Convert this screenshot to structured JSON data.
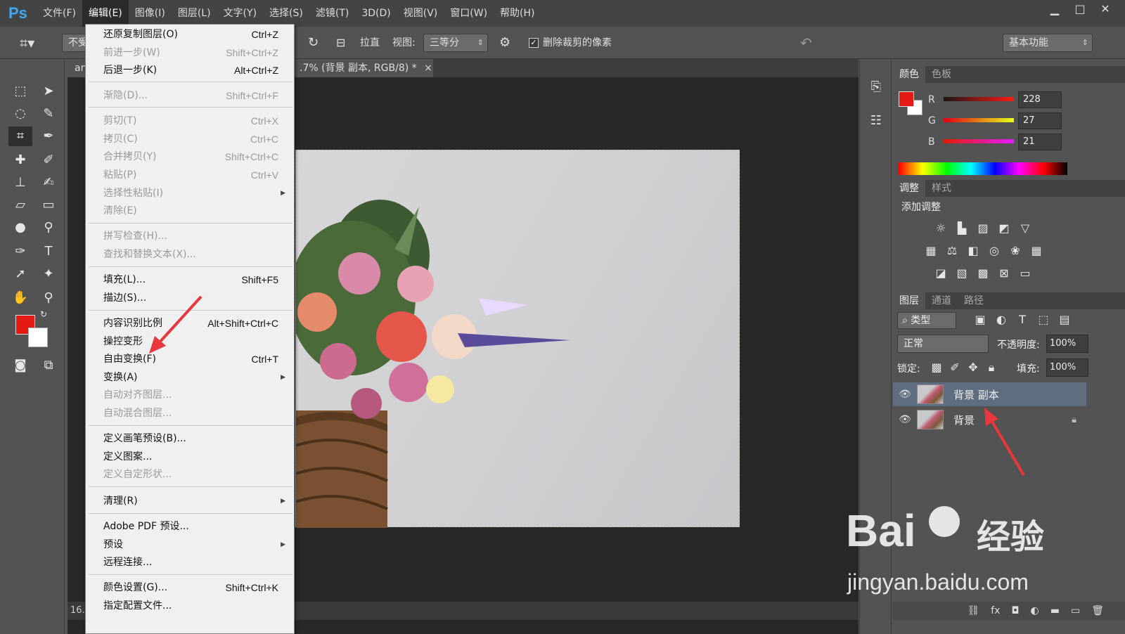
{
  "app": {
    "logo": "Ps"
  },
  "menubar": [
    {
      "label": "文件(F)"
    },
    {
      "label": "编辑(E)"
    },
    {
      "label": "图像(I)"
    },
    {
      "label": "图层(L)"
    },
    {
      "label": "文字(Y)"
    },
    {
      "label": "选择(S)"
    },
    {
      "label": "滤镜(T)"
    },
    {
      "label": "3D(D)"
    },
    {
      "label": "视图(V)"
    },
    {
      "label": "窗口(W)"
    },
    {
      "label": "帮助(H)"
    }
  ],
  "window_controls": {
    "minimize": "▁",
    "maximize": "□",
    "close": "✕"
  },
  "options_bar": {
    "ratio_label": "不受",
    "straighten": "拉直",
    "view_label": "视图:",
    "view_value": "三等分",
    "delete_cropped": "删除裁剪的像素",
    "workspace": "基本功能"
  },
  "document": {
    "tab_left": "an",
    "tab_title": ".7% (背景 副本, RGB/8) *",
    "tab_close": "×",
    "status": "16."
  },
  "edit_menu": [
    {
      "label": "还原复制图层(O)",
      "shortcut": "Ctrl+Z",
      "enabled": true
    },
    {
      "label": "前进一步(W)",
      "shortcut": "Shift+Ctrl+Z",
      "enabled": false
    },
    {
      "label": "后退一步(K)",
      "shortcut": "Alt+Ctrl+Z",
      "enabled": true
    },
    {
      "label": "渐隐(D)...",
      "shortcut": "Shift+Ctrl+F",
      "enabled": false
    },
    {
      "label": "剪切(T)",
      "shortcut": "Ctrl+X",
      "enabled": false
    },
    {
      "label": "拷贝(C)",
      "shortcut": "Ctrl+C",
      "enabled": false
    },
    {
      "label": "合并拷贝(Y)",
      "shortcut": "Shift+Ctrl+C",
      "enabled": false
    },
    {
      "label": "粘贴(P)",
      "shortcut": "Ctrl+V",
      "enabled": false
    },
    {
      "label": "选择性粘贴(I)",
      "shortcut": "",
      "enabled": false,
      "submenu": true
    },
    {
      "label": "清除(E)",
      "shortcut": "",
      "enabled": false
    },
    {
      "label": "拼写检查(H)...",
      "shortcut": "",
      "enabled": false
    },
    {
      "label": "查找和替换文本(X)...",
      "shortcut": "",
      "enabled": false
    },
    {
      "label": "填充(L)...",
      "shortcut": "Shift+F5",
      "enabled": true
    },
    {
      "label": "描边(S)...",
      "shortcut": "",
      "enabled": true
    },
    {
      "label": "内容识别比例",
      "shortcut": "Alt+Shift+Ctrl+C",
      "enabled": true
    },
    {
      "label": "操控变形",
      "shortcut": "",
      "enabled": true
    },
    {
      "label": "自由变换(F)",
      "shortcut": "Ctrl+T",
      "enabled": true
    },
    {
      "label": "变换(A)",
      "shortcut": "",
      "enabled": true,
      "submenu": true
    },
    {
      "label": "自动对齐图层...",
      "shortcut": "",
      "enabled": false
    },
    {
      "label": "自动混合图层...",
      "shortcut": "",
      "enabled": false
    },
    {
      "label": "定义画笔预设(B)...",
      "shortcut": "",
      "enabled": true
    },
    {
      "label": "定义图案...",
      "shortcut": "",
      "enabled": true
    },
    {
      "label": "定义自定形状...",
      "shortcut": "",
      "enabled": false
    },
    {
      "label": "清理(R)",
      "shortcut": "",
      "enabled": true,
      "submenu": true
    },
    {
      "label": "Adobe PDF 预设...",
      "shortcut": "",
      "enabled": true
    },
    {
      "label": "预设",
      "shortcut": "",
      "enabled": true,
      "submenu": true
    },
    {
      "label": "远程连接...",
      "shortcut": "",
      "enabled": true
    },
    {
      "label": "颜色设置(G)...",
      "shortcut": "Shift+Ctrl+K",
      "enabled": true
    },
    {
      "label": "指定配置文件...",
      "shortcut": "",
      "enabled": true
    }
  ],
  "color_panel": {
    "tabs": [
      "颜色",
      "色板"
    ],
    "r_label": "R",
    "g_label": "G",
    "b_label": "B",
    "r": "228",
    "g": "27",
    "b": "21",
    "foreground": "#e41b15",
    "background": "#ffffff"
  },
  "adjust_panel": {
    "tabs": [
      "调整",
      "样式"
    ],
    "heading": "添加调整"
  },
  "layers_panel": {
    "tabs": [
      "图层",
      "通道",
      "路径"
    ],
    "filter_label": "类型",
    "blend_mode": "正常",
    "opacity_label": "不透明度:",
    "opacity": "100%",
    "lock_label": "锁定:",
    "fill_label": "填充:",
    "fill": "100%",
    "layers": [
      {
        "name": "背景 副本"
      },
      {
        "name": "背景"
      }
    ]
  },
  "watermark": {
    "brand": "Bai",
    "brand2": "经验",
    "url": "jingyan.baidu.com"
  },
  "colors": {
    "accent_arrow": "#e8383d",
    "ps_blue": "#3fa9f5"
  }
}
